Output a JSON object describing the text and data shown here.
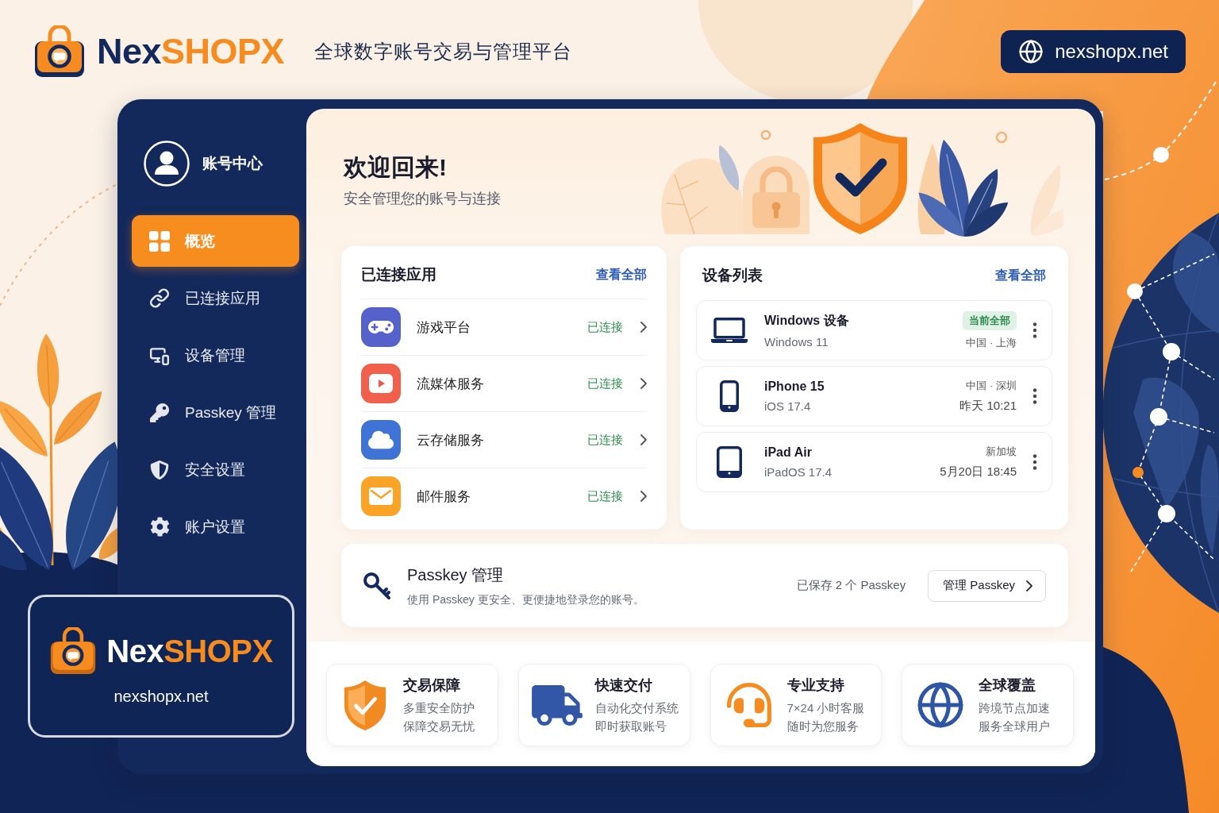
{
  "header": {
    "logo_text": {
      "part_1": "Nex",
      "part_2": "SHOPX"
    },
    "tagline": "全球数字账号交易与管理平台",
    "url": "nexshopx.net"
  },
  "sidebar": {
    "account_label": "账号中心",
    "items": [
      {
        "label": "概览",
        "selected": true
      },
      {
        "label": "已连接应用",
        "selected": false
      },
      {
        "label": "设备管理",
        "selected": false
      },
      {
        "label": "Passkey 管理",
        "selected": false
      },
      {
        "label": "安全设置",
        "selected": false
      },
      {
        "label": "账户设置",
        "selected": false
      }
    ]
  },
  "welcome": {
    "title": "欢迎回来!",
    "subtitle": "安全管理您的账号与连接"
  },
  "connected_apps": {
    "title": "已连接应用",
    "view_all": "查看全部",
    "items": [
      {
        "name": "游戏平台",
        "status": "已连接",
        "color": "#5662cb"
      },
      {
        "name": "流媒体服务",
        "status": "已连接",
        "color": "#f0604d"
      },
      {
        "name": "云存储服务",
        "status": "已连接",
        "color": "#3f73d6"
      },
      {
        "name": "邮件服务",
        "status": "已连接",
        "color": "#f9a426"
      }
    ]
  },
  "devices": {
    "title": "设备列表",
    "view_all": "查看全部",
    "items": [
      {
        "name": "Windows 设备",
        "os": "Windows 11",
        "badge": "当前全部",
        "location": "中国 · 上海"
      },
      {
        "name": "iPhone 15",
        "os": "iOS 17.4",
        "location": "中国 · 深圳",
        "last_seen": "昨天 10:21"
      },
      {
        "name": "iPad Air",
        "os": "iPadOS 17.4",
        "location": "新加坡",
        "last_seen": "5月20日 18:45"
      }
    ]
  },
  "passkey": {
    "title": "Passkey 管理",
    "description": "使用 Passkey 更安全、更便捷地登录您的账号。",
    "saved_count": "已保存 2 个 Passkey",
    "button": "管理 Passkey"
  },
  "features": [
    {
      "title": "交易保障",
      "lines": [
        "多重安全防护",
        "保障交易无忧"
      ]
    },
    {
      "title": "快速交付",
      "lines": [
        "自动化交付系统",
        "即时获取账号"
      ]
    },
    {
      "title": "专业支持",
      "lines": [
        "7×24 小时客服",
        "随时为您服务"
      ]
    },
    {
      "title": "全球覆盖",
      "lines": [
        "跨境节点加速",
        "服务全球用户"
      ]
    }
  ],
  "brand_card": {
    "logo_text": {
      "part_1": "Nex",
      "part_2": "SHOPX"
    },
    "url": "nexshopx.net"
  }
}
